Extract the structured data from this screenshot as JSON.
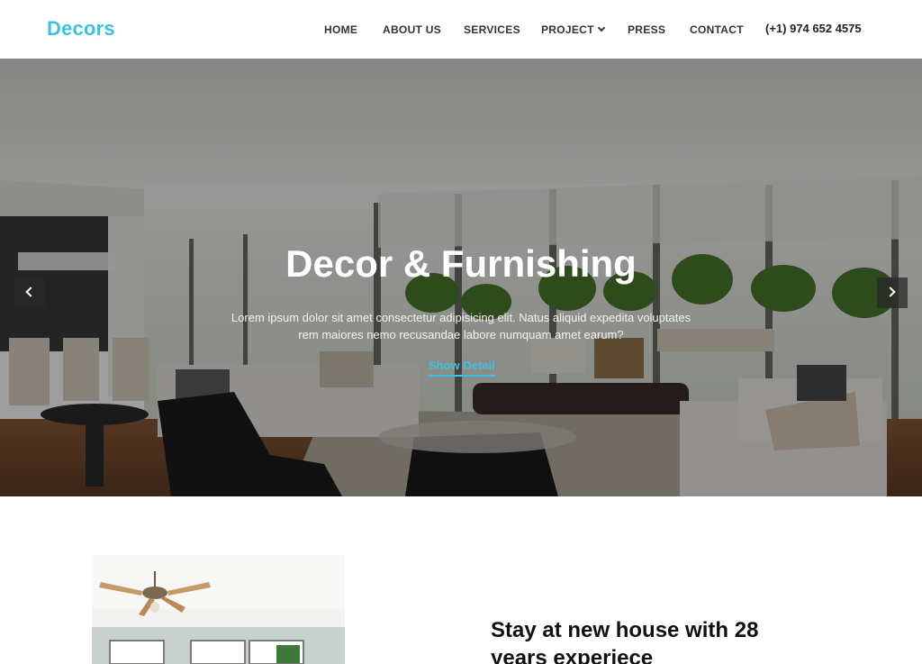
{
  "brand": {
    "logo": "Decors"
  },
  "nav": {
    "items": [
      {
        "label": "HOME"
      },
      {
        "label": "ABOUT US"
      },
      {
        "label": "SERVICES"
      },
      {
        "label": "PROJECT",
        "has_dropdown": true
      },
      {
        "label": "PRESS"
      },
      {
        "label": "CONTACT"
      }
    ],
    "phone": "(+1) 974 652 4575"
  },
  "hero": {
    "title": "Decor & Furnishing",
    "text": "Lorem ipsum dolor sit amet consectetur adipisicing elit. Natus aliquid expedita voluptates rem maiores nemo recusandae labore numquam amet earum?",
    "link_label": "Show Detail",
    "prev_icon": "chevron-left-icon",
    "next_icon": "chevron-right-icon"
  },
  "about": {
    "title": "Stay at new house with 28 years experiece"
  },
  "colors": {
    "accent": "#3ec1e0",
    "nav_text": "#333333",
    "overlay": "#000000"
  }
}
